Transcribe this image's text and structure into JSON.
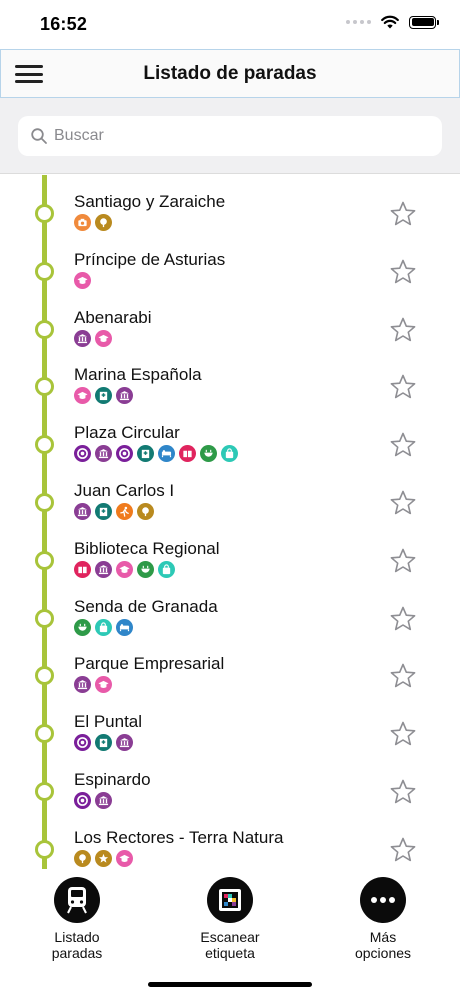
{
  "status_bar": {
    "time": "16:52"
  },
  "nav": {
    "title": "Listado de paradas",
    "menu_icon": "hamburger-menu-icon"
  },
  "search": {
    "placeholder": "Buscar",
    "value": ""
  },
  "colors": {
    "route_line": "#a8c43a",
    "poi": {
      "camera": "#f08a3c",
      "park": "#b98a1f",
      "university": "#e85aa9",
      "museum": "#8a3d94",
      "hospital": "#127a73",
      "metro": "#7a1f9a",
      "hotel": "#2f86c9",
      "library": "#e0245e",
      "restaurant": "#2e9a48",
      "shopping": "#2dc9b6",
      "sport": "#f07b1d",
      "zoo": "#b98a1f"
    }
  },
  "stops": [
    {
      "name": "Santiago y Zaraiche",
      "icons": [
        "camera",
        "park"
      ]
    },
    {
      "name": "Príncipe de Asturias",
      "icons": [
        "university"
      ]
    },
    {
      "name": "Abenarabi",
      "icons": [
        "museum",
        "university"
      ]
    },
    {
      "name": "Marina Española",
      "icons": [
        "university",
        "hospital",
        "museum"
      ]
    },
    {
      "name": "Plaza Circular",
      "icons": [
        "metro",
        "museum",
        "metro",
        "hospital",
        "hotel",
        "library",
        "restaurant",
        "shopping"
      ]
    },
    {
      "name": "Juan Carlos I",
      "icons": [
        "museum",
        "hospital",
        "sport",
        "park"
      ]
    },
    {
      "name": "Biblioteca Regional",
      "icons": [
        "library",
        "museum",
        "university",
        "restaurant",
        "shopping"
      ]
    },
    {
      "name": "Senda de Granada",
      "icons": [
        "restaurant",
        "shopping",
        "hotel"
      ]
    },
    {
      "name": "Parque Empresarial",
      "icons": [
        "museum",
        "university"
      ]
    },
    {
      "name": "El Puntal",
      "icons": [
        "metro",
        "hospital",
        "museum"
      ]
    },
    {
      "name": "Espinardo",
      "icons": [
        "metro",
        "museum"
      ]
    },
    {
      "name": "Los Rectores - Terra Natura",
      "icons": [
        "park",
        "zoo",
        "university"
      ]
    }
  ],
  "tabs": [
    {
      "id": "listado",
      "label_line1": "Listado",
      "label_line2": "paradas",
      "icon": "tram-icon"
    },
    {
      "id": "escanear",
      "label_line1": "Escanear",
      "label_line2": "etiqueta",
      "icon": "qr-scan-icon"
    },
    {
      "id": "mas",
      "label_line1": "Más",
      "label_line2": "opciones",
      "icon": "more-options-icon"
    }
  ]
}
